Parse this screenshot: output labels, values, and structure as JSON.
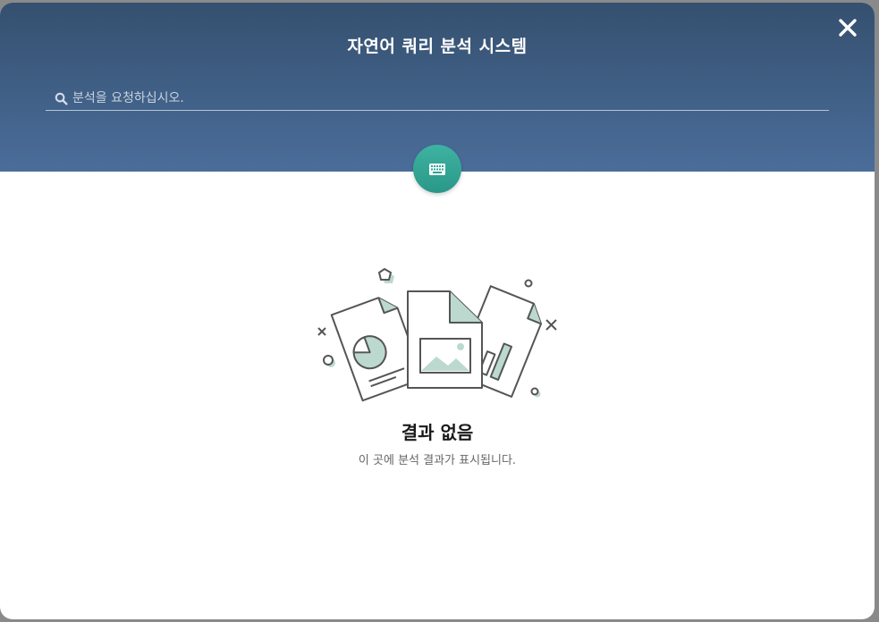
{
  "modal": {
    "title": "자연어 쿼리 분석 시스템",
    "close_icon": "close-icon"
  },
  "search": {
    "icon": "search-icon",
    "placeholder": "분석을 요청하십시오.",
    "value": ""
  },
  "keyboard_button": {
    "icon": "keyboard-icon",
    "color": "#2fa595"
  },
  "empty_state": {
    "illustration": "documents-illustration",
    "title": "결과 없음",
    "subtitle": "이 곳에 분석 결과가 표시됩니다."
  },
  "colors": {
    "header_top": "#35506f",
    "header_bottom": "#4a6d9a",
    "accent": "#2fa595",
    "illustration_fill": "#bcd9d0"
  }
}
